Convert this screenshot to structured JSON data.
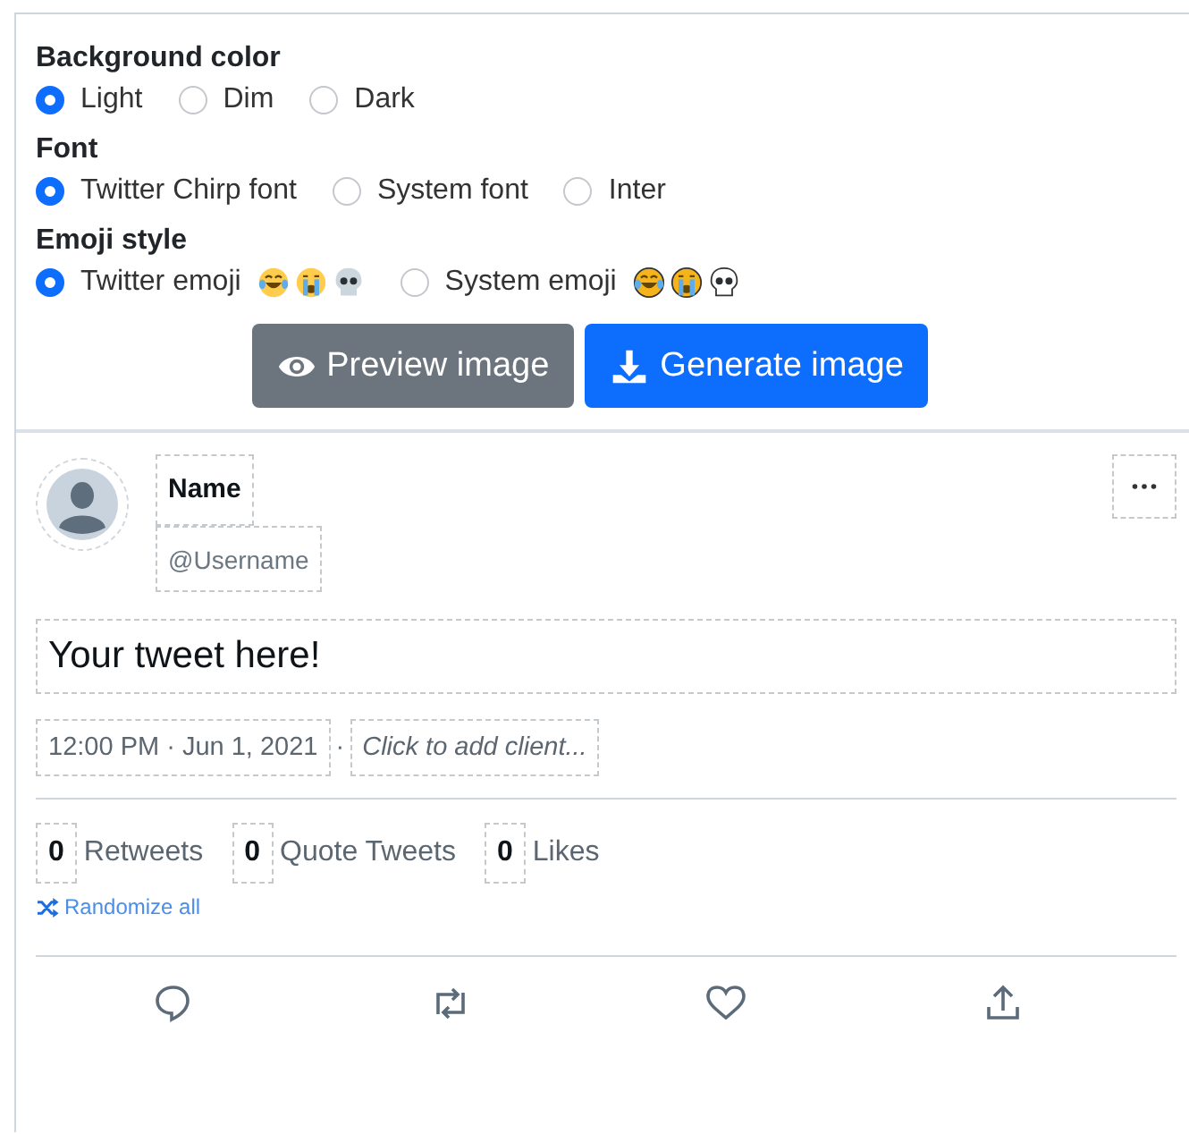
{
  "settings": [
    {
      "title": "Background color",
      "options": [
        {
          "label": "Light",
          "selected": true,
          "kind": "plain"
        },
        {
          "label": "Dim",
          "selected": false,
          "kind": "plain"
        },
        {
          "label": "Dark",
          "selected": false,
          "kind": "plain"
        }
      ]
    },
    {
      "title": "Font",
      "options": [
        {
          "label": "Twitter Chirp font",
          "selected": true,
          "kind": "plain"
        },
        {
          "label": "System font",
          "selected": false,
          "kind": "plain"
        },
        {
          "label": "Inter",
          "selected": false,
          "kind": "plain"
        }
      ]
    },
    {
      "title": "Emoji style",
      "options": [
        {
          "label": "Twitter emoji",
          "selected": true,
          "kind": "twemoji"
        },
        {
          "label": "System emoji",
          "selected": false,
          "kind": "sysemoji"
        }
      ]
    }
  ],
  "buttons": [
    {
      "label": "Preview image",
      "kind": "secondary"
    },
    {
      "label": "Generate image",
      "kind": "primary"
    }
  ],
  "tweet": {
    "name": "Name",
    "username": "@Username",
    "text": "Your tweet here!",
    "timestamp": "12:00 PM · Jun 1, 2021",
    "separator": "·",
    "client_placeholder": "Click to add client...",
    "stats": [
      {
        "count": "0",
        "label": "Retweets"
      },
      {
        "count": "0",
        "label": "Quote Tweets"
      },
      {
        "count": "0",
        "label": "Likes"
      }
    ],
    "randomize": "Randomize all"
  }
}
